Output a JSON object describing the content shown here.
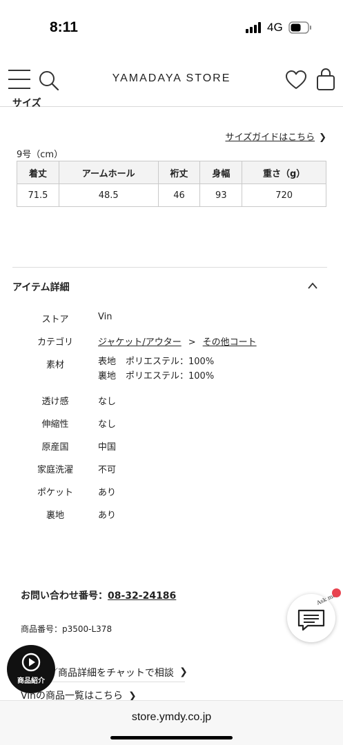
{
  "status": {
    "time": "8:11",
    "network": "4G"
  },
  "header": {
    "brand": "YAMADAYA STORE"
  },
  "size_section": {
    "cut_heading": "サイズ",
    "guide_link": "サイズガイドはこちら",
    "unit": "9号（cm）",
    "columns": [
      "着丈",
      "アームホール",
      "裄丈",
      "身幅",
      "重さ（g）"
    ],
    "rows": [
      [
        "71.5",
        "48.5",
        "46",
        "93",
        "720"
      ]
    ]
  },
  "item_details": {
    "title": "アイテム詳細",
    "store_label": "ストア",
    "store_value": "Vin",
    "category_label": "カテゴリ",
    "category_parent": "ジャケット/アウター",
    "category_sep": ">",
    "category_child": "その他コート",
    "material_label": "素材",
    "material_outer_part": "表地",
    "material_outer_value": "ポリエステル：100%",
    "material_lining_part": "裏地",
    "material_lining_value": "ポリエステル：100%",
    "sheer_label": "透け感",
    "sheer_value": "なし",
    "stretch_label": "伸縮性",
    "stretch_value": "なし",
    "origin_label": "原産国",
    "origin_value": "中国",
    "wash_label": "家庭洗濯",
    "wash_value": "不可",
    "pocket_label": "ポケット",
    "pocket_value": "あり",
    "lining_label": "裏地",
    "lining_value": "あり"
  },
  "footer": {
    "inquiry_label": "お問い合わせ番号：",
    "inquiry_number": "08-32-24186",
    "product_number": "商品番号：p3500-L378",
    "chat_consult": "／商品詳細をチャットで相談",
    "brand_list": "Vinの商品一覧はこちら"
  },
  "floating": {
    "video_label": "商品紹介",
    "ask_text": "Ask me"
  },
  "url_bar": {
    "url": "store.ymdy.co.jp"
  },
  "colors": {
    "notification_dot": "#e8434f",
    "video_button": "#111111"
  }
}
